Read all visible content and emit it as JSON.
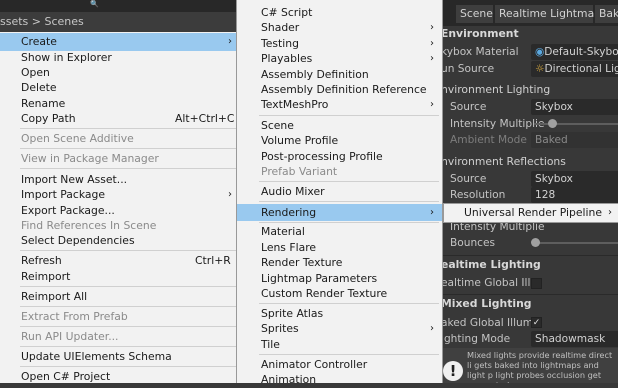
{
  "project": {
    "breadcrumb": "ssets > Scenes"
  },
  "menu1": {
    "items": [
      {
        "label": "Create",
        "arrow": "›",
        "selected": true
      },
      {
        "label": "Show in Explorer"
      },
      {
        "label": "Open"
      },
      {
        "label": "Delete"
      },
      {
        "label": "Rename"
      },
      {
        "label": "Copy Path",
        "shortcut": "Alt+Ctrl+C"
      },
      {
        "label": "Open Scene Additive",
        "disabled": true
      },
      {
        "label": "View in Package Manager",
        "disabled": true
      },
      {
        "label": "Import New Asset..."
      },
      {
        "label": "Import Package",
        "arrow": "›"
      },
      {
        "label": "Export Package..."
      },
      {
        "label": "Find References In Scene",
        "disabled": true
      },
      {
        "label": "Select Dependencies"
      },
      {
        "label": "Refresh",
        "shortcut": "Ctrl+R"
      },
      {
        "label": "Reimport"
      },
      {
        "label": "Reimport All"
      },
      {
        "label": "Extract From Prefab",
        "disabled": true
      },
      {
        "label": "Run API Updater...",
        "disabled": true
      },
      {
        "label": "Update UIElements Schema"
      },
      {
        "label": "Open C# Project"
      }
    ]
  },
  "menu2": {
    "items": [
      {
        "label": "C# Script"
      },
      {
        "label": "Shader",
        "arrow": "›"
      },
      {
        "label": "Testing",
        "arrow": "›"
      },
      {
        "label": "Playables",
        "arrow": "›"
      },
      {
        "label": "Assembly Definition"
      },
      {
        "label": "Assembly Definition Reference"
      },
      {
        "label": "TextMeshPro",
        "arrow": "›"
      },
      {
        "label": "Scene"
      },
      {
        "label": "Volume Profile"
      },
      {
        "label": "Post-processing Profile"
      },
      {
        "label": "Prefab Variant",
        "disabled": true
      },
      {
        "label": "Audio Mixer"
      },
      {
        "label": "Rendering",
        "arrow": "›",
        "selected": true
      },
      {
        "label": "Material"
      },
      {
        "label": "Lens Flare"
      },
      {
        "label": "Render Texture"
      },
      {
        "label": "Lightmap Parameters"
      },
      {
        "label": "Custom Render Texture"
      },
      {
        "label": "Sprite Atlas"
      },
      {
        "label": "Sprites",
        "arrow": "›"
      },
      {
        "label": "Tile"
      },
      {
        "label": "Animator Controller"
      },
      {
        "label": "Animation"
      }
    ]
  },
  "menu3": {
    "item": {
      "label": "Universal Render Pipeline",
      "arrow": "›"
    }
  },
  "lighting": {
    "tabs": [
      "Scene",
      "Realtime Lightmaps",
      "Bak"
    ],
    "environment": {
      "header": "Environment",
      "skybox_material_label": "kybox Material",
      "skybox_material_value": "Default-Skybox",
      "sun_source_label": "un Source",
      "sun_source_value": "Directional Ligh"
    },
    "env_lighting": {
      "header": "nvironment Lighting",
      "source_label": "Source",
      "source_value": "Skybox",
      "intensity_label": "Intensity Multiplie",
      "ambient_mode_label": "Ambient Mode",
      "ambient_mode_value": "Baked"
    },
    "env_reflections": {
      "header": "nvironment Reflections",
      "source_label": "Source",
      "source_value": "Skybox",
      "resolution_label": "Resolution",
      "resolution_value": "128",
      "intensity_label": "Intensity Multiplie",
      "bounces_label": "Bounces"
    },
    "realtime": {
      "header": "ealtime Lighting",
      "gi_label": "ealtime Global Illur"
    },
    "mixed": {
      "header": "Mixed Lighting",
      "baked_gi_label": "aked Global Illumir",
      "baked_gi_check": "✓",
      "mode_label": "ighting Mode",
      "mode_value": "Shadowmask",
      "help_text": "Mixed lights provide realtime direct li gets baked into lightmaps and light p light probes occlusion get generated"
    }
  },
  "colors": {
    "menu_bg": "#f2f2f2",
    "menu_selected": "#99c9ef",
    "panel_bg": "#383838"
  }
}
